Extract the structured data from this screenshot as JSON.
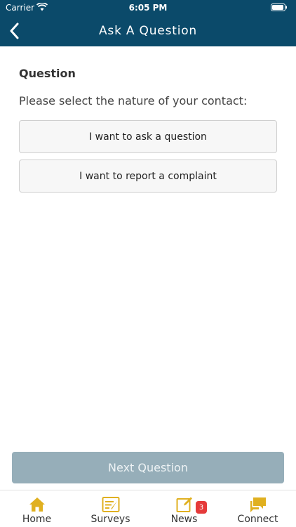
{
  "status_bar": {
    "carrier": "Carrier",
    "time": "6:05 PM"
  },
  "header": {
    "title": "Ask A Question",
    "back_icon": "chevron-left-icon"
  },
  "content": {
    "section_title": "Question",
    "prompt": "Please select the nature of your contact:",
    "options": [
      {
        "label": "I want to ask a question"
      },
      {
        "label": "I want to report a complaint"
      }
    ],
    "next_label": "Next Question"
  },
  "tabbar": {
    "items": [
      {
        "label": "Home",
        "icon": "home-icon"
      },
      {
        "label": "Surveys",
        "icon": "survey-icon"
      },
      {
        "label": "News",
        "icon": "news-icon",
        "badge": "3"
      },
      {
        "label": "Connect",
        "icon": "chat-icon"
      }
    ]
  },
  "colors": {
    "header": "#0b4a6a",
    "accent": "#e0b020",
    "button_disabled": "#96aeb9",
    "badge": "#e53a3a"
  }
}
